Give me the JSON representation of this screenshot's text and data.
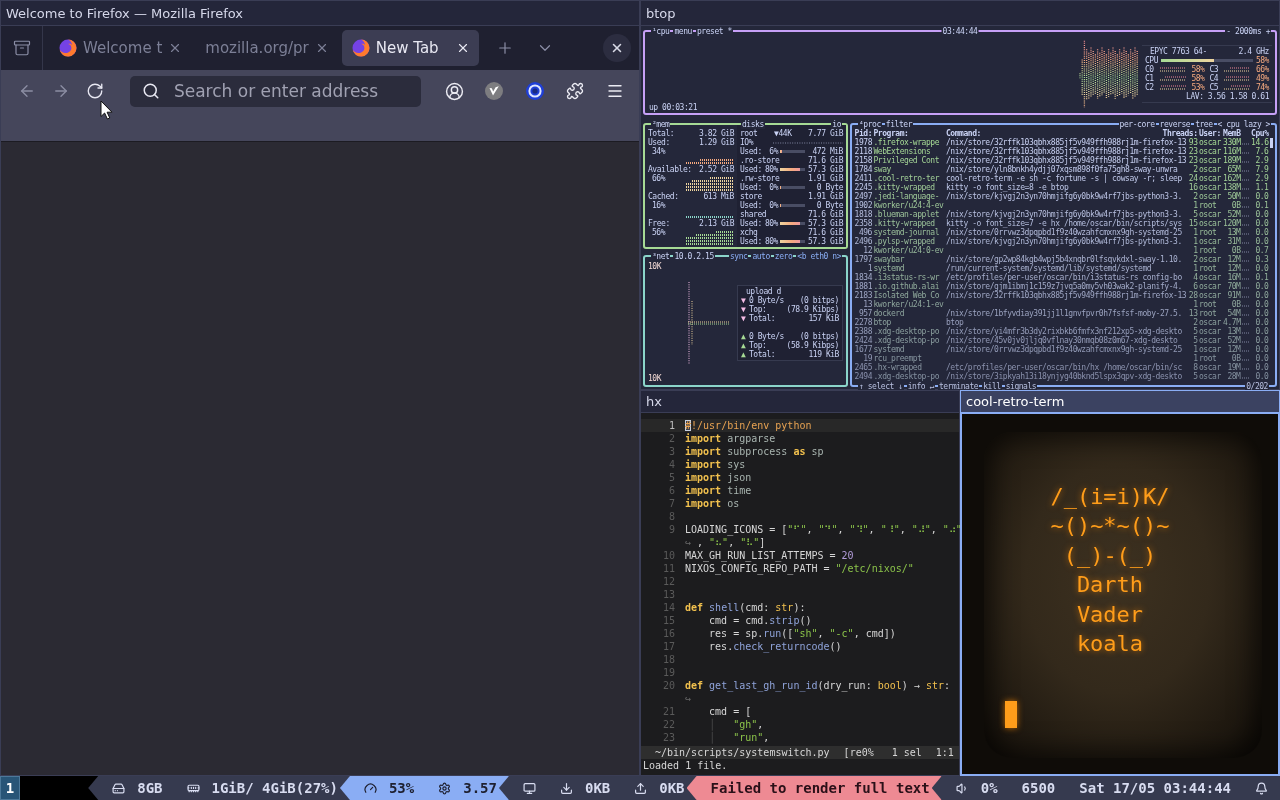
{
  "firefox": {
    "window_title": "Welcome to Firefox — Mozilla Firefox",
    "focused": false,
    "tabs": [
      {
        "label": "Welcome t",
        "favicon": true,
        "selected": false
      },
      {
        "label": "mozilla.org/pr",
        "favicon": false,
        "selected": false
      },
      {
        "label": "New Tab",
        "favicon": true,
        "selected": true
      }
    ],
    "nav": [
      {
        "kind": "back",
        "disabled": true
      },
      {
        "kind": "forward",
        "disabled": true
      },
      {
        "kind": "reload",
        "disabled": false
      }
    ],
    "address_bar": {
      "placeholder": "Search or enter address"
    }
  },
  "btop": {
    "window_title": "btop",
    "focused": false,
    "cpu": {
      "header": [
        "¹cpu",
        "menu",
        "preset *"
      ],
      "clock": "03:44:44",
      "interval": "- 2000ms +",
      "uptime": "up 00:03:21",
      "model": "EPYC 7763 64-",
      "frequency": "2.4 GHz",
      "total": {
        "label": "CPU",
        "level": 0.58,
        "reading": "58%"
      },
      "cores": [
        {
          "label": "C0",
          "reading": "58%"
        },
        {
          "label": "C1",
          "reading": "58%"
        },
        {
          "label": "C2",
          "reading": "53%"
        },
        {
          "label": "C3",
          "reading": "66%"
        },
        {
          "label": "C4",
          "reading": "49%"
        },
        {
          "label": "C5",
          "reading": "74%"
        }
      ],
      "load": "LAV: 3.56 1.58 0.61"
    },
    "mem": {
      "title": "²mem",
      "rows": [
        {
          "label": "Total:",
          "value": "3.82 GiB"
        },
        {
          "label": "Used:",
          "value": "1.29 GiB",
          "percent": "34%",
          "color": "#f5a97f"
        },
        {
          "label": "Available:",
          "value": "2.52 GiB",
          "percent": "66%",
          "color": "#eed49f"
        },
        {
          "label": "Cached:",
          "value": "613 MiB",
          "percent": "16%",
          "color": "#8bd5ca"
        },
        {
          "label": "Free:",
          "value": "2.13 GiB",
          "percent": "56%",
          "color": "#a6da95"
        }
      ]
    },
    "disks": {
      "title": "disks",
      "toggle": "io",
      "items": [
        {
          "name": "root",
          "io": "▼44K",
          "size": "7.77 GiB",
          "io_label": "IO%",
          "used_label": "Used:",
          "used_percent": "6%",
          "level": 0.06,
          "used": "472 MiB"
        },
        {
          "name": ".ro-store",
          "size": "71.6 GiB",
          "used_label": "Used:",
          "used_percent": "80%",
          "level": 0.8,
          "used": "57.3 GiB"
        },
        {
          "name": ".rw-store",
          "size": "1.91 GiB",
          "used_label": "Used:",
          "used_percent": "0%",
          "level": 0,
          "used": "0 Byte"
        },
        {
          "name": "store",
          "size": "1.91 GiB",
          "used_label": "Used:",
          "used_percent": "0%",
          "level": 0,
          "used": "0 Byte"
        },
        {
          "name": "shared",
          "size": "71.6 GiB",
          "used_label": "Used:",
          "used_percent": "80%",
          "level": 0.8,
          "used": "57.3 GiB"
        },
        {
          "name": "xchg",
          "size": "71.6 GiB",
          "used_label": "Used:",
          "used_percent": "80%",
          "level": 0.8,
          "used": "57.3 GiB"
        }
      ]
    },
    "net": {
      "title": "³net",
      "address": "10.0.2.15",
      "controls": [
        "sync",
        "auto",
        "zero",
        "<b eth0 n>"
      ],
      "scale_top": "10K",
      "scale_bottom": "10K",
      "stats_title": "upload d",
      "download": [
        {
          "arrow": "▼",
          "label": "0 Byte/s",
          "value": "(0 bitps)"
        },
        {
          "arrow": "▼",
          "label": "Top:",
          "value": "(78.9 Kibps)"
        },
        {
          "arrow": "▼",
          "label": "Total:",
          "value": "157 KiB"
        }
      ],
      "upload": [
        {
          "arrow": "▲",
          "label": "0 Byte/s",
          "value": "(0 bitps)"
        },
        {
          "arrow": "▲",
          "label": "Top:",
          "value": "(58.9 Kibps)"
        },
        {
          "arrow": "▲",
          "label": "Total:",
          "value": "119 KiB"
        }
      ]
    },
    "proc": {
      "header": [
        "⁴proc",
        "filter"
      ],
      "options": [
        "per-core",
        "reverse",
        "tree",
        "< cpu lazy >"
      ],
      "columns": [
        "Pid:",
        "Program:",
        "Command:",
        "Threads:",
        "User:",
        "MemB",
        "Cpu%"
      ],
      "rows": [
        {
          "pid": "1978",
          "program": ".firefox-wrappe",
          "command": "/nix/store/32rffk103qbhx885jf5v949ffh988rj1m-firefox-13",
          "threads": "93",
          "user": "oscar",
          "mem": "330M",
          "cpu": "14.6"
        },
        {
          "pid": "2118",
          "program": "WebExtensions",
          "command": "/nix/store/32rffk103qbhx885jf5v949ffh988rj1m-firefox-13",
          "threads": "23",
          "user": "oscar",
          "mem": "116M",
          "cpu": "7.6"
        },
        {
          "pid": "2158",
          "program": "Privileged Cont",
          "command": "/nix/store/32rffk103qbhx885jf5v949ffh988rj1m-firefox-13",
          "threads": "23",
          "user": "oscar",
          "mem": "189M",
          "cpu": "2.9"
        },
        {
          "pid": "1784",
          "program": "sway",
          "command": "/nix/store/yln8bnkh4ydjj07xqsm898f0fa75gh8-sway-unwra",
          "threads": "2",
          "user": "oscar",
          "mem": "65M",
          "cpu": "7.9"
        },
        {
          "pid": "2411",
          "program": ".cool-retro-ter",
          "command": "cool-retro-term -e sh -c fortune -s | cowsay -r; sleep",
          "threads": "24",
          "user": "oscar",
          "mem": "162M",
          "cpu": "2.9"
        },
        {
          "pid": "2245",
          "program": ".kitty-wrapped",
          "command": "kitty -o font_size=8 -e btop",
          "threads": "16",
          "user": "oscar",
          "mem": "138M",
          "cpu": "1.1"
        },
        {
          "pid": "2497",
          "program": ".jedi-language-",
          "command": "/nix/store/kjvgj2n3yn70hmjifg6y0bk9w4rf7jbs-python3-3.",
          "threads": "2",
          "user": "oscar",
          "mem": "50M",
          "cpu": "0.0"
        },
        {
          "pid": "1902",
          "program": "kworker/u24:4-ev",
          "threads": "1",
          "user": "root",
          "mem": "0B",
          "cpu": "0.1"
        },
        {
          "pid": "1818",
          "program": ".blueman-applet",
          "command": "/nix/store/kjvgj2n3yn70hmjifg6y0bk9w4rf7jbs-python3-3.",
          "threads": "5",
          "user": "oscar",
          "mem": "52M",
          "cpu": "0.0"
        },
        {
          "pid": "2358",
          "program": ".kitty-wrapped",
          "command": "kitty -o font_size=7 -e hx /home/oscar/bin/scripts/sys",
          "threads": "15",
          "user": "oscar",
          "mem": "120M",
          "cpu": "0.0"
        },
        {
          "pid": "496",
          "program": "systemd-journal",
          "command": "/nix/store/0rrvwz3dpqpbd1f9z40wzahfcmxnx9gh-systemd-25",
          "threads": "1",
          "user": "root",
          "mem": "13M",
          "cpu": "0.0"
        },
        {
          "pid": "2496",
          "program": ".pylsp-wrapped",
          "command": "/nix/store/kjvgj2n3yn70hmjifg6y0bk9w4rf7jbs-python3-3.",
          "threads": "1",
          "user": "oscar",
          "mem": "31M",
          "cpu": "0.0"
        },
        {
          "pid": "12",
          "program": "kworker/u24:0-ev",
          "threads": "1",
          "user": "root",
          "mem": "0B",
          "cpu": "0.7"
        },
        {
          "pid": "1797",
          "program": "swaybar",
          "command": "/nix/store/gp2wp84kgb4wpj5b4xnqbr0lfsqvkdxl-sway-1.10.",
          "threads": "2",
          "user": "oscar",
          "mem": "12M",
          "cpu": "0.3"
        },
        {
          "pid": "1",
          "program": "systemd",
          "command": "/run/current-system/systemd/lib/systemd/systemd",
          "threads": "1",
          "user": "root",
          "mem": "12M",
          "cpu": "0.0"
        },
        {
          "pid": "1834",
          "program": ".i3status-rs-wr",
          "command": "/etc/profiles/per-user/oscar/bin/i3status-rs config-bo",
          "threads": "4",
          "user": "oscar",
          "mem": "16M",
          "cpu": "0.1"
        },
        {
          "pid": "1881",
          "program": ".io.github.alai",
          "command": "/nix/store/gjm1ibmj1c159z7jvq5a0my5vh03wak2-planify-4.",
          "threads": "6",
          "user": "oscar",
          "mem": "70M",
          "cpu": "0.0"
        },
        {
          "pid": "2183",
          "program": "Isolated Web Co",
          "command": "/nix/store/32rffk103qbhx885jf5v949ffh988rj1m-firefox-13",
          "threads": "28",
          "user": "oscar",
          "mem": "91M",
          "cpu": "0.0"
        },
        {
          "pid": "13",
          "program": "kworker/u24:1-ev",
          "threads": "1",
          "user": "root",
          "mem": "0B",
          "cpu": "0.0"
        },
        {
          "pid": "957",
          "program": "dockerd",
          "command": "/nix/store/1bfyvdiay391jj1l1gnvfpvr0h7fsfsf-moby-27.5.",
          "threads": "13",
          "user": "root",
          "mem": "54M",
          "cpu": "0.0"
        },
        {
          "pid": "2278",
          "program": "btop",
          "command": "btop",
          "threads": "2",
          "user": "oscar",
          "mem": "4.7M",
          "cpu": "0.0"
        },
        {
          "pid": "2388",
          "program": ".xdg-desktop-po",
          "command": "/nix/store/yi4mfr3b3dy2rixbkb6fmfx3nf212xp5-xdg-deskto",
          "threads": "5",
          "user": "oscar",
          "mem": "13M",
          "cpu": "0.0"
        },
        {
          "pid": "2424",
          "program": ".xdg-desktop-po",
          "command": "/nix/store/45v0jv0jljq0vflnay30nmqb08z0m67-xdg-deskto",
          "threads": "5",
          "user": "oscar",
          "mem": "52M",
          "cpu": "0.0"
        },
        {
          "pid": "1677",
          "program": "systemd",
          "command": "/nix/store/0rrvwz3dpqpbd1f9z40wzahfcmxnx9gh-systemd-25",
          "threads": "1",
          "user": "oscar",
          "mem": "12M",
          "cpu": "0.0"
        },
        {
          "pid": "19",
          "program": "rcu_preempt",
          "threads": "1",
          "user": "root",
          "mem": "0B",
          "cpu": "0.0"
        },
        {
          "pid": "2465",
          "program": ".hx-wrapped",
          "command": "/etc/profiles/per-user/oscar/bin/hx /home/oscar/bin/sc",
          "threads": "8",
          "user": "oscar",
          "mem": "19M",
          "cpu": "0.0"
        },
        {
          "pid": "2494",
          "program": ".xdg-desktop-po",
          "command": "/nix/store/3ipkyah13i18ynjyg40bknd5lspx3qpv-xdg-deskto",
          "threads": "5",
          "user": "oscar",
          "mem": "28M",
          "cpu": "0.0"
        }
      ],
      "footer": [
        "↑ select ↓",
        "info ↵",
        "terminate",
        "kill",
        "signals"
      ],
      "count": "0/202"
    }
  },
  "editor": {
    "window_title": "hx",
    "focused": false,
    "rows": [
      {
        "number": "1",
        "current": true,
        "tokens": [
          {
            "text": "#",
            "kind": "shebang",
            "cursor": true
          },
          {
            "text": "!/usr/bin/env python",
            "kind": "shebang"
          }
        ]
      },
      {
        "number": "2",
        "tokens": [
          {
            "text": "import",
            "kind": "keyword"
          },
          {
            "text": " argparse",
            "kind": "name"
          }
        ]
      },
      {
        "number": "3",
        "tokens": [
          {
            "text": "import",
            "kind": "keyword"
          },
          {
            "text": " subprocess ",
            "kind": "name"
          },
          {
            "text": "as",
            "kind": "keyword"
          },
          {
            "text": " sp",
            "kind": "name"
          }
        ]
      },
      {
        "number": "4",
        "tokens": [
          {
            "text": "import",
            "kind": "keyword"
          },
          {
            "text": " sys",
            "kind": "name"
          }
        ]
      },
      {
        "number": "5",
        "tokens": [
          {
            "text": "import",
            "kind": "keyword"
          },
          {
            "text": " json",
            "kind": "name"
          }
        ]
      },
      {
        "number": "6",
        "tokens": [
          {
            "text": "import",
            "kind": "keyword"
          },
          {
            "text": " time",
            "kind": "name"
          }
        ]
      },
      {
        "number": "7",
        "tokens": [
          {
            "text": "import",
            "kind": "keyword"
          },
          {
            "text": " os",
            "kind": "name"
          }
        ]
      },
      {
        "number": "8"
      },
      {
        "number": "9",
        "tokens": [
          {
            "text": "LOADING_ICONS = [",
            "kind": "plain"
          },
          {
            "text": "\"⠋\"",
            "kind": "string"
          },
          {
            "text": ", ",
            "kind": "plain"
          },
          {
            "text": "\"⠙\"",
            "kind": "string"
          },
          {
            "text": ", ",
            "kind": "plain"
          },
          {
            "text": "\"⠹\"",
            "kind": "string"
          },
          {
            "text": ", ",
            "kind": "plain"
          },
          {
            "text": "\"⠸\"",
            "kind": "string"
          },
          {
            "text": ", ",
            "kind": "plain"
          },
          {
            "text": "\"⠼\"",
            "kind": "string"
          },
          {
            "text": ", ",
            "kind": "plain"
          },
          {
            "text": "\"⠴\"",
            "kind": "string"
          }
        ]
      },
      {
        "tokens": [
          {
            "text": "↪",
            "kind": "wrap"
          },
          {
            "text": " , ",
            "kind": "plain"
          },
          {
            "text": "\"⠦\"",
            "kind": "string"
          },
          {
            "text": ", ",
            "kind": "plain"
          },
          {
            "text": "\"⠧\"",
            "kind": "string"
          },
          {
            "text": "]",
            "kind": "plain"
          }
        ]
      },
      {
        "number": "10",
        "tokens": [
          {
            "text": "MAX_GH_RUN_LIST_ATTEMPS = ",
            "kind": "plain"
          },
          {
            "text": "20",
            "kind": "number"
          }
        ]
      },
      {
        "number": "11",
        "tokens": [
          {
            "text": "NIXOS_CONFIG_REPO_PATH = ",
            "kind": "plain"
          },
          {
            "text": "\"/etc/nixos/\"",
            "kind": "string"
          }
        ]
      },
      {
        "number": "12"
      },
      {
        "number": "13"
      },
      {
        "number": "14",
        "tokens": [
          {
            "text": "def ",
            "kind": "keyword"
          },
          {
            "text": "shell",
            "kind": "function"
          },
          {
            "text": "(cmd: ",
            "kind": "plain"
          },
          {
            "text": "str",
            "kind": "type"
          },
          {
            "text": "):",
            "kind": "plain"
          }
        ]
      },
      {
        "number": "15",
        "tokens": [
          {
            "text": "    cmd = cmd.",
            "kind": "plain"
          },
          {
            "text": "strip",
            "kind": "function"
          },
          {
            "text": "()",
            "kind": "plain"
          }
        ]
      },
      {
        "number": "16",
        "tokens": [
          {
            "text": "    res = sp.",
            "kind": "plain"
          },
          {
            "text": "run",
            "kind": "function"
          },
          {
            "text": "([",
            "kind": "plain"
          },
          {
            "text": "\"sh\"",
            "kind": "string"
          },
          {
            "text": ", ",
            "kind": "plain"
          },
          {
            "text": "\"-c\"",
            "kind": "string"
          },
          {
            "text": ", cmd])",
            "kind": "plain"
          }
        ]
      },
      {
        "number": "17",
        "tokens": [
          {
            "text": "    res.",
            "kind": "plain"
          },
          {
            "text": "check_returncode",
            "kind": "function"
          },
          {
            "text": "()",
            "kind": "plain"
          }
        ]
      },
      {
        "number": "18"
      },
      {
        "number": "19"
      },
      {
        "number": "20",
        "tokens": [
          {
            "text": "def ",
            "kind": "keyword"
          },
          {
            "text": "get_last_gh_run_id",
            "kind": "function"
          },
          {
            "text": "(dry_run: ",
            "kind": "plain"
          },
          {
            "text": "bool",
            "kind": "type"
          },
          {
            "text": ") → ",
            "kind": "plain"
          },
          {
            "text": "str",
            "kind": "type"
          },
          {
            "text": ":",
            "kind": "plain"
          }
        ]
      },
      {
        "tokens": [
          {
            "text": "↪",
            "kind": "wrap"
          }
        ]
      },
      {
        "number": "21",
        "tokens": [
          {
            "text": "    cmd = [",
            "kind": "plain"
          }
        ]
      },
      {
        "number": "22",
        "tokens": [
          {
            "text": "    │",
            "kind": "guide"
          },
          {
            "text": "   \"gh\"",
            "kind": "string"
          },
          {
            "text": ",",
            "kind": "plain"
          }
        ]
      },
      {
        "number": "23",
        "tokens": [
          {
            "text": "    │",
            "kind": "guide"
          },
          {
            "text": "   \"run\"",
            "kind": "string"
          },
          {
            "text": ",",
            "kind": "plain"
          }
        ]
      }
    ],
    "status": {
      "file": "~/bin/scripts/systemswitch.py",
      "flags": "[re0%",
      "selections": "1 sel",
      "position": "1:1"
    },
    "message": "Loaded 1 file."
  },
  "terminal": {
    "window_title": "cool-retro-term",
    "focused": true,
    "lines": [
      "/_(i=i)K/",
      "~()~*~()~",
      "(_)-(_)",
      "Darth",
      "Vader",
      "koala"
    ],
    "cursor": true
  },
  "status_bar": {
    "workspaces": [
      {
        "label": "1",
        "selected": true
      }
    ],
    "blocks": [
      {
        "kind": "idle",
        "items": [
          {
            "kind": "drive",
            "text": "8GB"
          },
          {
            "kind": "memory",
            "text": "1GiB/ 4GiB(27%)"
          }
        ]
      },
      {
        "kind": "info",
        "items": [
          {
            "kind": "gauge",
            "text": "53%"
          },
          {
            "kind": "gear",
            "text": "3.57"
          }
        ]
      },
      {
        "kind": "idle",
        "items": [
          {
            "kind": "monitor"
          },
          {
            "kind": "download",
            "text": "0KB"
          },
          {
            "kind": "upload",
            "text": "0KB"
          }
        ]
      },
      {
        "kind": "critical",
        "items": [
          {
            "kind": "plain",
            "text": "Failed to render full text"
          }
        ]
      },
      {
        "kind": "idle",
        "items": [
          {
            "kind": "speaker",
            "text": "0%"
          },
          {
            "kind": "plain",
            "text": "6500"
          },
          {
            "kind": "plain",
            "text": "Sat 17/05 03:44:44"
          },
          {
            "kind": "bell"
          }
        ]
      }
    ]
  }
}
